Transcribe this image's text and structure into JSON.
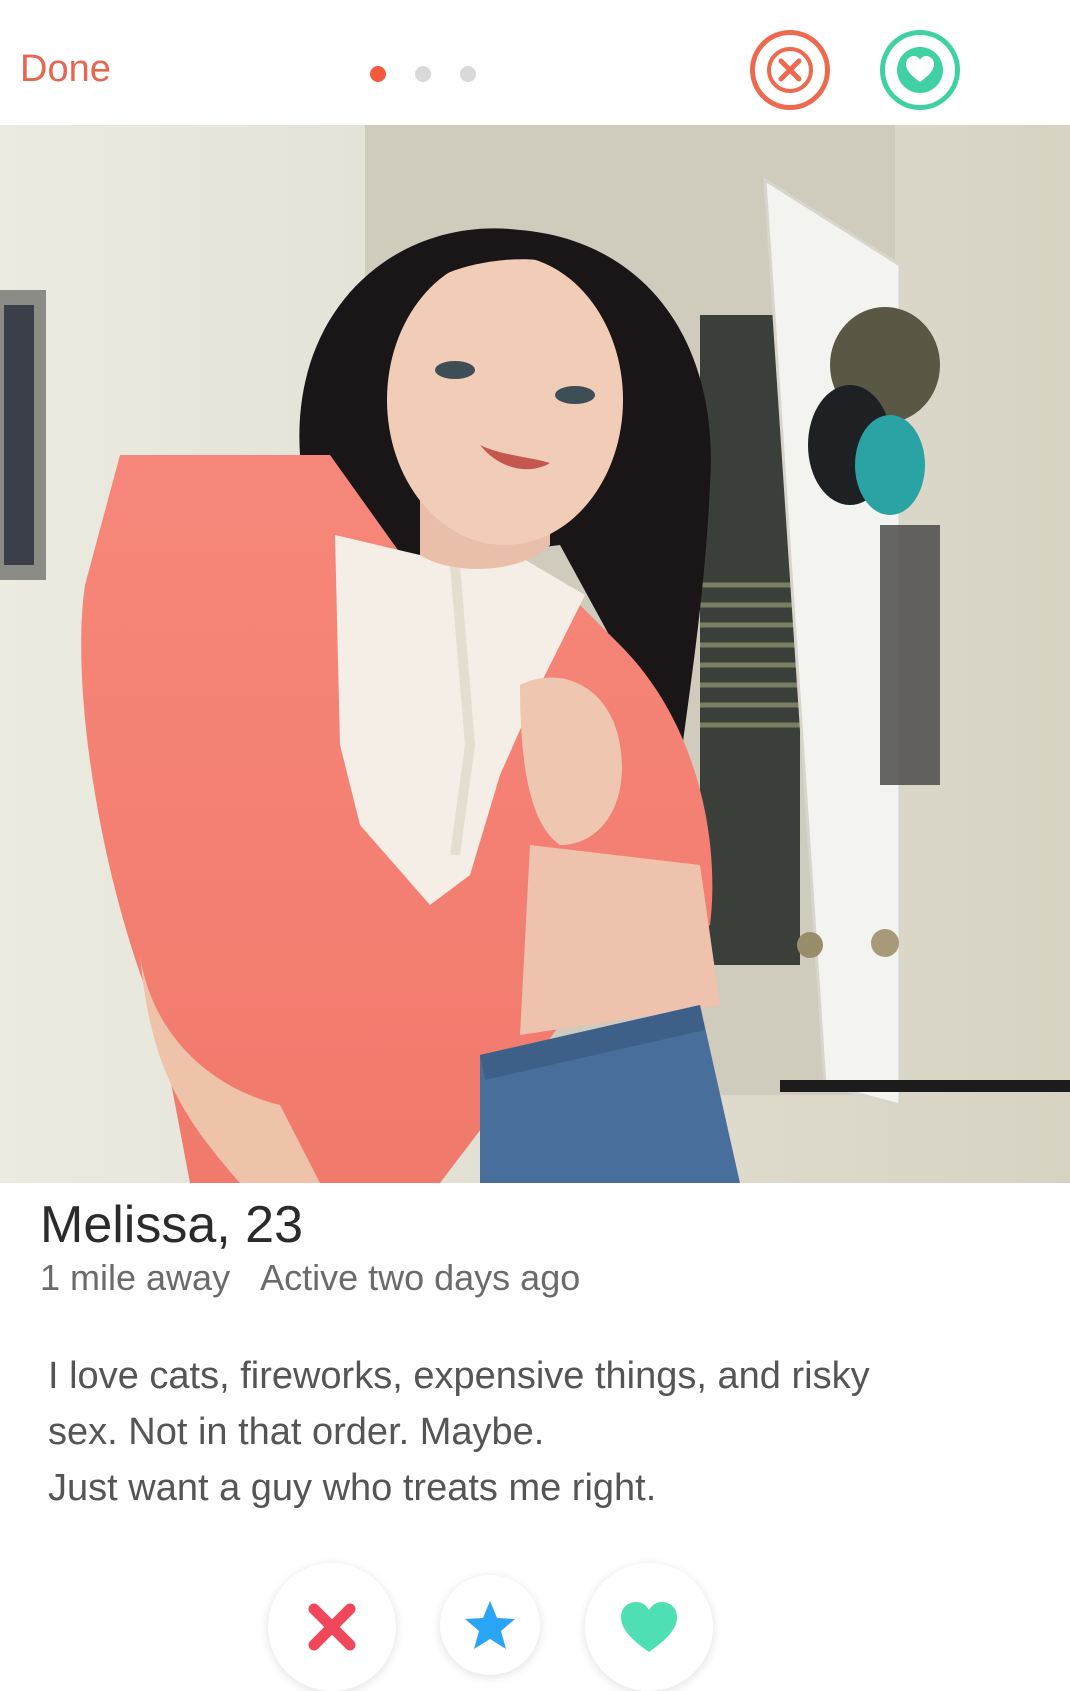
{
  "topbar": {
    "done_label": "Done",
    "page_dots": {
      "total": 3,
      "active": 1
    }
  },
  "profile": {
    "name_age": "Melissa, 23",
    "distance": "1 mile away",
    "activity": "Active two days ago",
    "bio_lines": [
      "I love cats, fireworks, expensive things, and risky",
      "sex. Not in that order. Maybe.",
      "Just want a guy who treats me right."
    ]
  },
  "icons": {
    "top_nope": "close-circle-icon",
    "top_like": "heart-circle-icon",
    "bottom_nope": "x-icon",
    "bottom_super": "star-icon",
    "bottom_like": "heart-icon"
  },
  "colors": {
    "accent_red": "#ee6a4f",
    "accent_green": "#3fd1a3",
    "super_blue": "#2aa4f4",
    "dot_active": "#f25a3c"
  }
}
